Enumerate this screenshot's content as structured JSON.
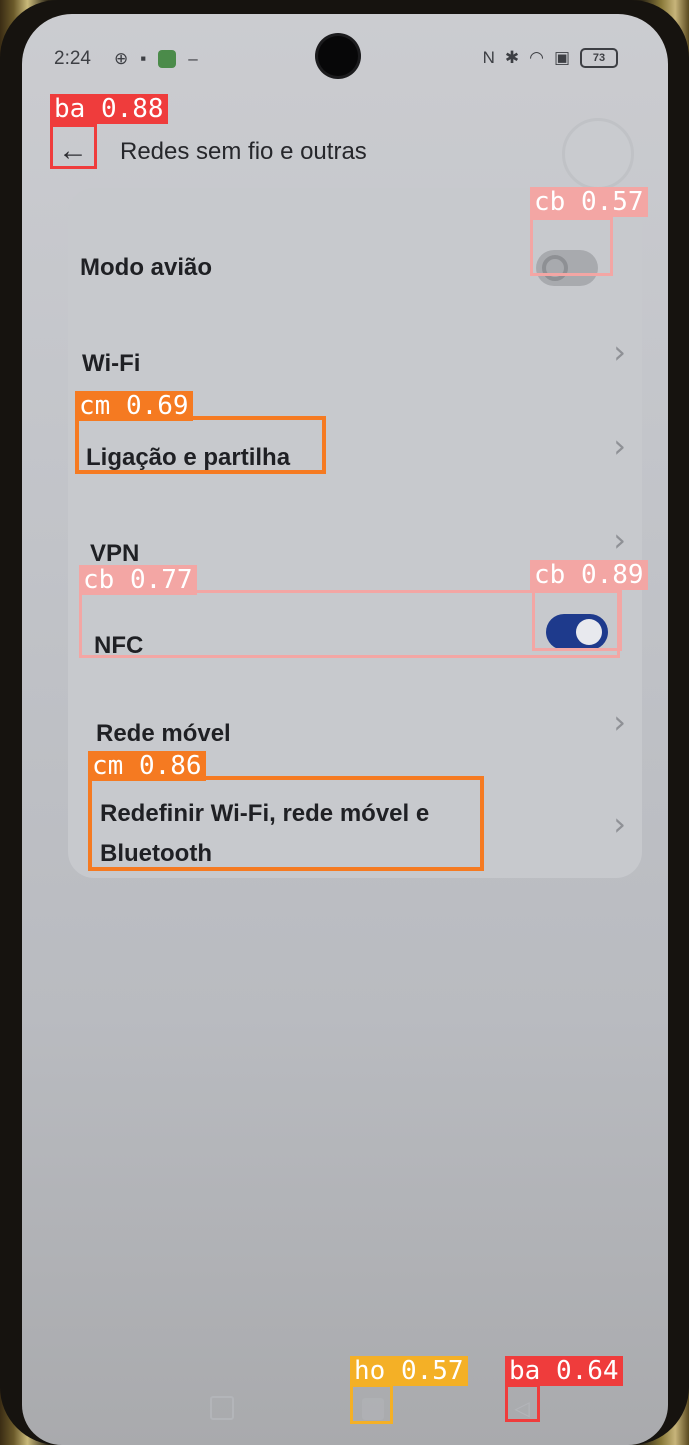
{
  "status_bar": {
    "time": "2:24",
    "left_icons": [
      "sync-icon",
      "notification-icon",
      "app-notification-icon",
      "more-icon"
    ],
    "right_icons": [
      "nfc-icon",
      "bluetooth-icon",
      "wifi-icon",
      "sim-icon",
      "battery-icon"
    ],
    "battery": "73"
  },
  "header": {
    "title": "Redes sem fio e outras",
    "back_icon": "←"
  },
  "settings": {
    "airplane_mode": {
      "label": "Modo avião",
      "enabled": false
    },
    "wifi": {
      "label": "Wi-Fi"
    },
    "hotspot": {
      "label": "Ligação e partilha"
    },
    "vpn": {
      "label": "VPN"
    },
    "nfc": {
      "label": "NFC",
      "enabled": true
    },
    "mobile_network": {
      "label": "Rede móvel"
    },
    "reset": {
      "label_line1": "Redefinir Wi-Fi, rede móvel e",
      "label_line2": "Bluetooth"
    }
  },
  "chevron": "›",
  "detections": {
    "back": "ba 0.88",
    "airplane_toggle": "cb 0.57",
    "hotspot": "cm 0.69",
    "nfc_row": "cb 0.77",
    "nfc_toggle": "cb 0.89",
    "reset": "cm 0.86",
    "home": "ho 0.57",
    "nav_back": "ba 0.64"
  },
  "colors": {
    "toggle_on": "#1e3a8c",
    "ba": "#ef3c3c",
    "cb": "#f3a6a4",
    "cm": "#f57a21",
    "ho": "#f4b026"
  }
}
